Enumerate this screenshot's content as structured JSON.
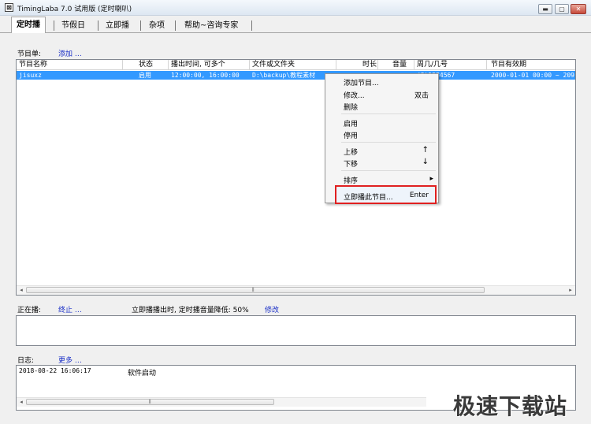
{
  "window": {
    "icon_glyph": "⊠",
    "title": "TimingLaba 7.0 试用版 (定时喇叭)",
    "controls": {
      "minimize": "▬",
      "maximize": "▢",
      "close": "✕"
    }
  },
  "tabs": [
    {
      "label": "定时播"
    },
    {
      "label": "节假日"
    },
    {
      "label": "立即播"
    },
    {
      "label": "杂项"
    },
    {
      "label": "帮助~咨询专家"
    }
  ],
  "program_list": {
    "label": "节目单:",
    "add_link": "添加 …",
    "columns": [
      "节目名称",
      "状态",
      "播出时间, 可多个",
      "文件或文件夹",
      "时长",
      "音量",
      "周几/几号",
      "节目有效期"
    ],
    "rows": [
      {
        "name": "jisuxz",
        "status": "启用",
        "times": "12:00:00, 16:00:00",
        "file": "D:\\backup\\教程素材",
        "duration": "",
        "volume": "",
        "days": "(2)1234567",
        "validity": "2000-01-01 00:00 ~ 209"
      }
    ]
  },
  "now_playing": {
    "label": "正在播:",
    "stop_link": "终止 …",
    "info": "立即播播出时, 定时播音量降低: 50%",
    "modify_link": "修改"
  },
  "log": {
    "label": "日志:",
    "more_link": "更多 …",
    "entries": [
      {
        "time": "2018-08-22 16:06:17",
        "message": "软件启动"
      }
    ]
  },
  "context_menu": {
    "items": [
      {
        "label": "添加节目...",
        "shortcut": ""
      },
      {
        "label": "修改...",
        "shortcut": "双击"
      },
      {
        "label": "删除",
        "shortcut": ""
      },
      {
        "label": "启用",
        "shortcut": ""
      },
      {
        "label": "停用",
        "shortcut": ""
      },
      {
        "label": "上移",
        "shortcut": "↑"
      },
      {
        "label": "下移",
        "shortcut": "↓"
      },
      {
        "label": "排序",
        "shortcut": "▸"
      },
      {
        "label": "立即播此节目...",
        "shortcut": "Enter"
      }
    ],
    "highlight_color": "#e02020"
  },
  "scroll": {
    "left_arrow": "◂",
    "right_arrow": "▸",
    "grip": "⦀"
  },
  "watermark": "极速下载站"
}
